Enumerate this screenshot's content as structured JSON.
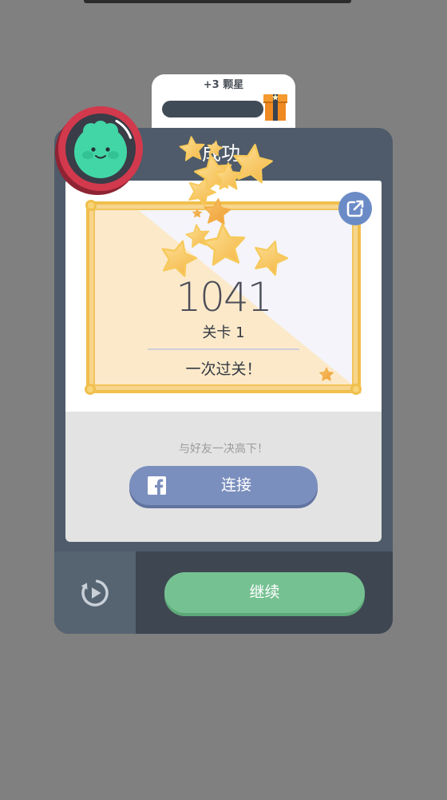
{
  "reward_tab": {
    "label": "+3 颗星",
    "gift_icon": "gift-box-icon"
  },
  "card": {
    "title": "成功"
  },
  "avatar": {
    "icon": "green-character-avatar-icon"
  },
  "result": {
    "score": "1041",
    "level": "关卡 1",
    "message": "一次过关！"
  },
  "share": {
    "icon": "share-icon"
  },
  "social": {
    "prompt": "与好友一决高下！",
    "connect_label": "连接",
    "connect_icon": "facebook-icon"
  },
  "actions": {
    "replay_icon": "replay-icon",
    "continue_label": "继续"
  },
  "decorations": {
    "icon": "star-icon"
  },
  "colors": {
    "background": "#808080",
    "card": "#4f5b6a",
    "card_footer": "#3e4652",
    "continue_button": "#76c192",
    "facebook_button": "#7b8fbe",
    "share_button": "#6b8bc6",
    "avatar_ring": "#d2394c",
    "frame_gold": "#f0bf4c"
  }
}
